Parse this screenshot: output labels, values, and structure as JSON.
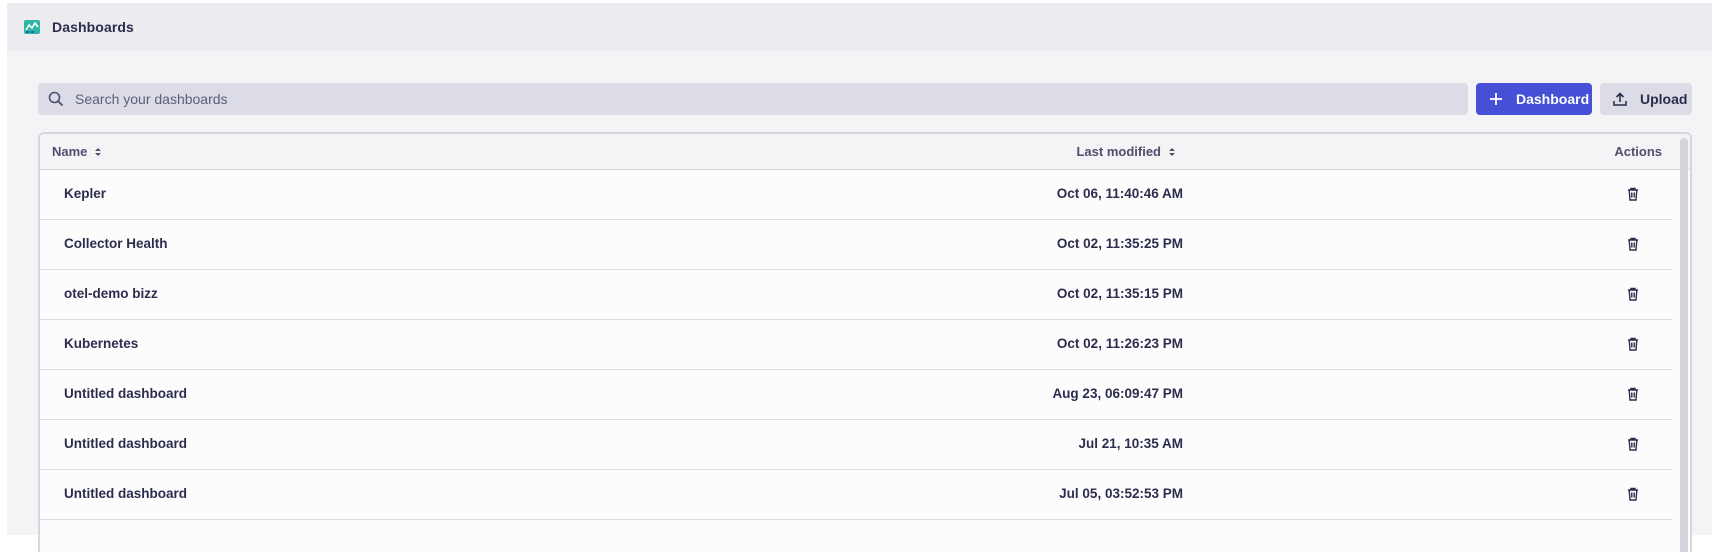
{
  "header": {
    "app_icon": "dashboards-app-icon",
    "title": "Dashboards"
  },
  "toolbar": {
    "search_placeholder": "Search your dashboards",
    "search_value": "",
    "add_label": "Dashboard",
    "upload_label": "Upload"
  },
  "table": {
    "columns": {
      "name": "Name",
      "modified": "Last modified",
      "actions": "Actions"
    },
    "rows": [
      {
        "name": "Kepler",
        "modified": "Oct 06, 11:40:46 AM"
      },
      {
        "name": "Collector Health",
        "modified": "Oct 02, 11:35:25 PM"
      },
      {
        "name": "otel-demo bizz",
        "modified": "Oct 02, 11:35:15 PM"
      },
      {
        "name": "Kubernetes",
        "modified": "Oct 02, 11:26:23 PM"
      },
      {
        "name": "Untitled dashboard",
        "modified": "Aug 23, 06:09:47 PM"
      },
      {
        "name": "Untitled dashboard",
        "modified": "Jul 21, 10:35 AM"
      },
      {
        "name": "Untitled dashboard",
        "modified": "Jul 05, 03:52:53 PM"
      }
    ]
  },
  "colors": {
    "primary": "#4650d6",
    "background": "#f4f4f7",
    "text": "#2c2d4d"
  }
}
